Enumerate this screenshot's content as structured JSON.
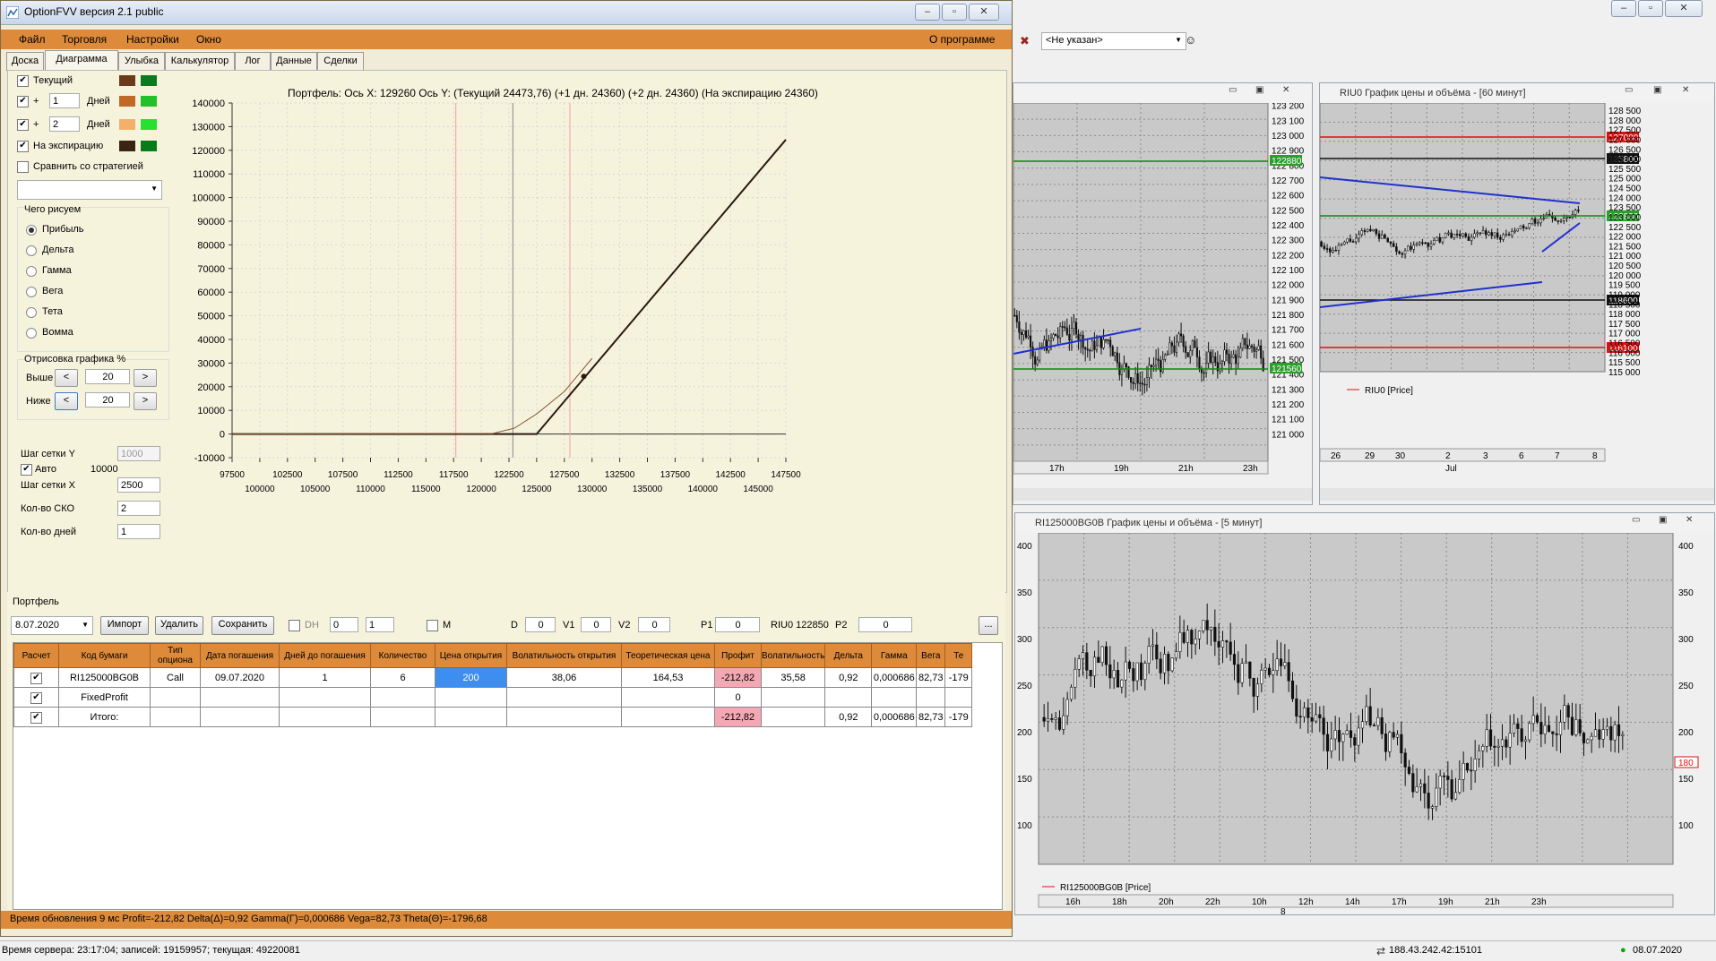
{
  "window": {
    "title": "OptionFVV версия 2.1 public"
  },
  "menu": {
    "items": [
      "Файл",
      "Торговля",
      "Настройки",
      "Окно"
    ],
    "about": "О программе"
  },
  "tabs": [
    "Доска",
    "Диаграмма",
    "Улыбка",
    "Калькулятор",
    "Лог",
    "Данные",
    "Сделки"
  ],
  "left_panel": {
    "current": "Текущий",
    "plus": "+",
    "days_label": "Дней",
    "days1": "1",
    "days2": "2",
    "expiry": "На экспирацию",
    "compare": "Сравнить со стратегией",
    "draw_group": "Чего рисуем",
    "options": [
      "Прибыль",
      "Дельта",
      "Гамма",
      "Вега",
      "Тета",
      "Вомма"
    ],
    "draw_pct": "Отрисовка графика %",
    "above": "Выше",
    "below": "Ниже",
    "above_val": "20",
    "below_val": "20",
    "btn_left": "<",
    "btn_right": ">",
    "grid_y_label": "Шаг сетки Y",
    "grid_y_val": "1000",
    "auto": "Авто",
    "auto_val": "10000",
    "grid_x_label": "Шаг сетки X",
    "grid_x_val": "2500",
    "sko_label": "Кол-во СКО",
    "sko_val": "2",
    "days_count_label": "Кол-во дней",
    "days_count_val": "1"
  },
  "colors": {
    "current": "#6b3a1a",
    "current2": "#0e7a20",
    "d1": "#c06a28",
    "d1b": "#22c02a",
    "d2": "#f2b06a",
    "d2b": "#28e030",
    "exp": "#3a2412",
    "expb": "#0a7a1a",
    "accent": "#dd8a3a"
  },
  "chart_header": "Портфель:  Ось X:  129260  Ось Y:   (Текущий 24473,76)   (+1 дн. 24360)   (+2 дн. 24360)   (На экспирацию 24360)",
  "chart_data": {
    "type": "line",
    "title": "Портфель:  Ось X:  129260  Ось Y:   (Текущий 24473,76)   (+1 дн. 24360)   (+2 дн. 24360)   (На экспирацию 24360)",
    "xlim": [
      97500,
      147500
    ],
    "ylim": [
      -10000,
      140000
    ],
    "yticks": [
      "140000",
      "130000",
      "120000",
      "110000",
      "100000",
      "90000",
      "80000",
      "70000",
      "60000",
      "50000",
      "40000",
      "30000",
      "20000",
      "10000",
      "0",
      "-10000"
    ],
    "xticks_top": [
      "97500",
      "102500",
      "107500",
      "112500",
      "117500",
      "122500",
      "127500",
      "132500",
      "137500",
      "142500",
      "147500"
    ],
    "xticks_bottom": [
      "100000",
      "105000",
      "110000",
      "115000",
      "120000",
      "125000",
      "130000",
      "135000",
      "140000",
      "145000"
    ],
    "series": [
      {
        "name": "На экспирацию",
        "x": [
          97500,
          125000,
          147500
        ],
        "y": [
          0,
          0,
          124500
        ]
      },
      {
        "name": "Текущий",
        "x": [
          97500,
          121000,
          123000,
          125000,
          127500,
          130000
        ],
        "y": [
          0,
          200,
          2500,
          8500,
          18000,
          32000
        ]
      }
    ],
    "marker": {
      "x": 129260,
      "y": 24360
    },
    "vlines": [
      117700,
      122850,
      128000
    ]
  },
  "portfolio": {
    "label": "Портфель",
    "date": "8.07.2020",
    "import": "Импорт",
    "delete": "Удалить",
    "save": "Сохранить",
    "dh": "DH",
    "spin1": "0",
    "spin2": "1",
    "m": "M",
    "d_label": "D",
    "d_val": "0",
    "v1_label": "V1",
    "v1_val": "0",
    "v2_label": "V2",
    "v2_val": "0",
    "p1_label": "P1",
    "p1_val": "0",
    "riu": "RIU0 122850",
    "p2_label": "P2",
    "p2_val": "0",
    "extra_btn": "...",
    "headers": [
      "Расчет",
      "Код бумаги",
      "Тип опциона",
      "Дата погашения",
      "Дней до погашения",
      "Количество",
      "Цена открытия",
      "Волатильность открытия",
      "Теоретическая цена",
      "Профит",
      "Волатильность",
      "Дельта",
      "Гамма",
      "Вега",
      "Те"
    ],
    "rows": [
      [
        "✔",
        "RI125000BG0B",
        "Call",
        "09.07.2020",
        "1",
        "6",
        "200",
        "38,06",
        "164,53",
        "-212,82",
        "35,58",
        "0,92",
        "0,000686",
        "82,73",
        "-179"
      ],
      [
        "✔",
        "FixedProfit",
        "",
        "",
        "",
        "",
        "",
        "",
        "",
        "0",
        "",
        "",
        "",
        "",
        ""
      ],
      [
        "✔",
        "Итого:",
        "",
        "",
        "",
        "",
        "",
        "",
        "",
        "-212,82",
        "",
        "0,92",
        "0,000686",
        "82,73",
        "-179"
      ]
    ]
  },
  "status_main": "Время обновления 9 мс  Profit=-212,82 Delta(Δ)=0,92 Gamma(Γ)=0,000686 Vega=82,73 Theta(Θ)=-1796,68",
  "right": {
    "combo": "<Не указан>",
    "chart1": {
      "yticks": [
        "123 200",
        "123 100",
        "123 000",
        "122 900",
        "122 800",
        "122 700",
        "122 600",
        "122 500",
        "122 400",
        "122 300",
        "122 200",
        "122 100",
        "122 000",
        "121 900",
        "121 800",
        "121 700",
        "121 600",
        "121 500",
        "121 400",
        "121 300",
        "121 200",
        "121 100",
        "121 000"
      ],
      "xticks": [
        "17h",
        "19h",
        "21h",
        "23h"
      ],
      "price_green_top": "122880",
      "price_green_bottom": "121560"
    },
    "chart2": {
      "title": "RIU0 График цены и объёма - [60 минут]",
      "yticks": [
        "128 500",
        "128 000",
        "127 500",
        "127 000",
        "126 500",
        "126 000",
        "125 500",
        "125 000",
        "124 500",
        "124 000",
        "123 500",
        "123 000",
        "122 500",
        "122 000",
        "121 500",
        "121 000",
        "120 500",
        "120 000",
        "119 500",
        "119 000",
        "118 500",
        "118 000",
        "117 500",
        "117 000",
        "116 500",
        "116 000",
        "115 500",
        "115 000"
      ],
      "xticks": [
        "26",
        "29",
        "30",
        "2",
        "3",
        "6",
        "7",
        "8"
      ],
      "month": "Jul",
      "legend": "RIU0 [Price]",
      "p_red_top": "127000",
      "p_black_top": "125800",
      "p_green": "122880",
      "p_black_bottom": "118600",
      "p_red_bottom": "116100"
    },
    "chart3": {
      "title": "RI125000BG0B График цены и объёма - [5 минут]",
      "yticks": [
        "400",
        "350",
        "300",
        "250",
        "200",
        "150",
        "100"
      ],
      "xticks": [
        "16h",
        "18h",
        "20h",
        "22h",
        "10h",
        "12h",
        "14h",
        "17h",
        "19h",
        "21h",
        "23h"
      ],
      "day": "8",
      "legend": "RI125000BG0B [Price]",
      "last": "180"
    }
  },
  "bottom": {
    "server": "Время сервера: 23:17:04; записей: 19159957; текущая: 49220081",
    "ip": "188.43.242.42:15101",
    "date": "08.07.2020"
  }
}
